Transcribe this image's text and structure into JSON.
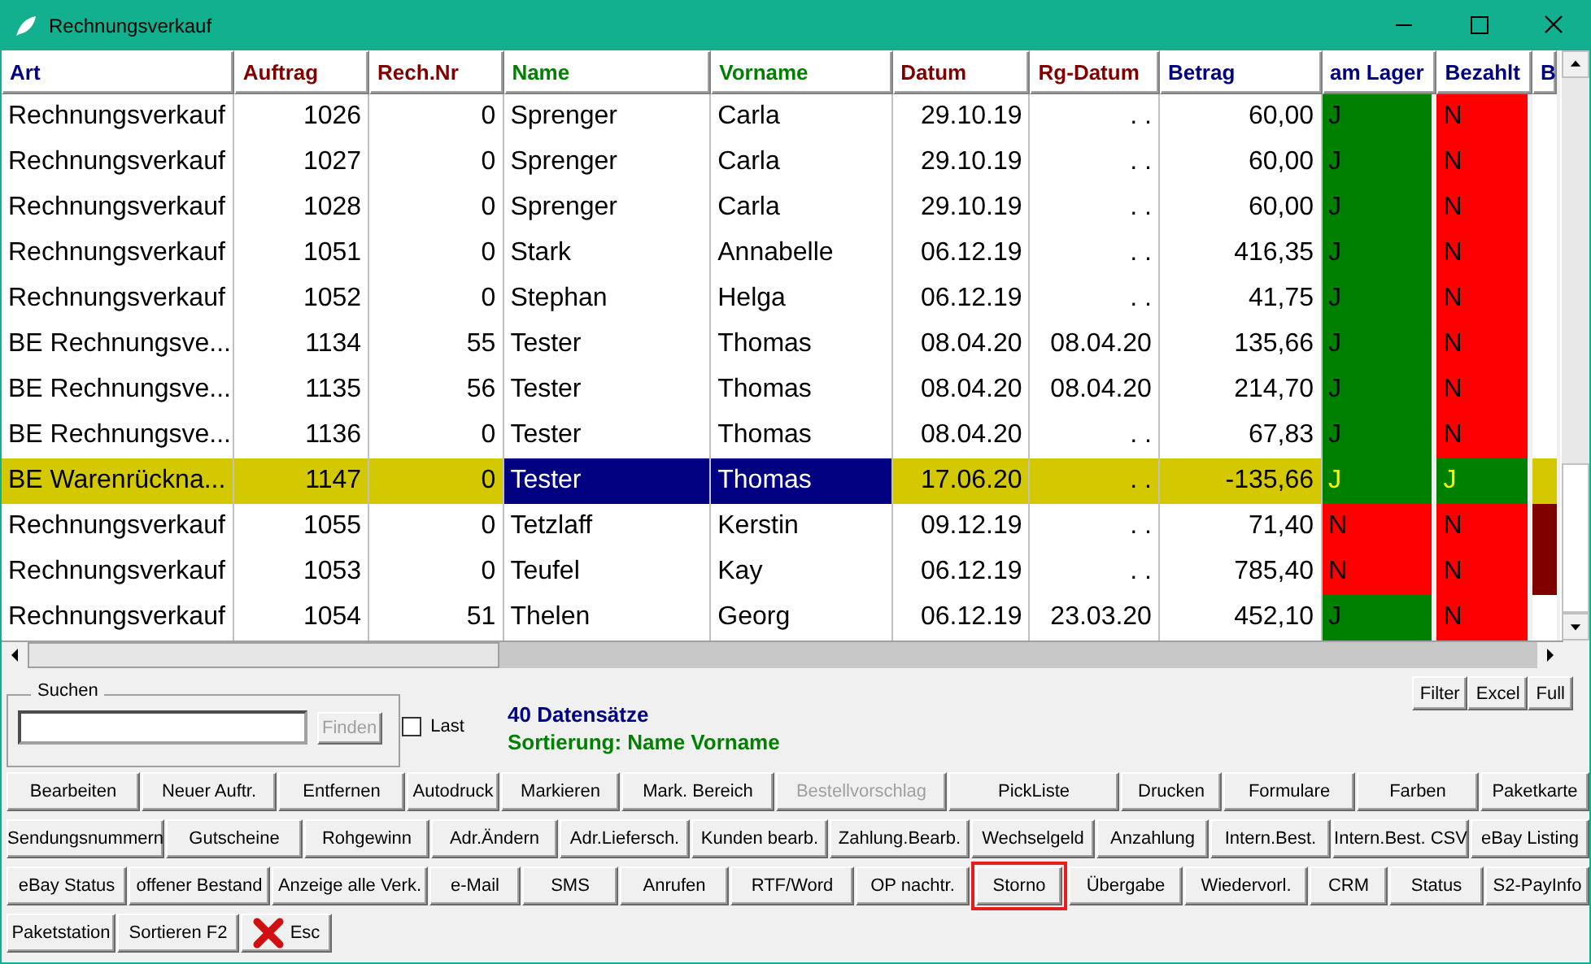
{
  "window": {
    "title": "Rechnungsverkauf"
  },
  "table": {
    "columns": [
      {
        "label": "Art",
        "color": "#000080"
      },
      {
        "label": "Auftrag",
        "color": "#800000"
      },
      {
        "label": "Rech.Nr",
        "color": "#800000"
      },
      {
        "label": "Name",
        "color": "#008000"
      },
      {
        "label": "Vorname",
        "color": "#008000"
      },
      {
        "label": "Datum",
        "color": "#800000"
      },
      {
        "label": "Rg-Datum",
        "color": "#800000"
      },
      {
        "label": "Betrag",
        "color": "#000080"
      },
      {
        "label": "am Lager",
        "color": "#000080"
      },
      {
        "label": "Bezahlt",
        "color": "#000080"
      },
      {
        "label": "B",
        "color": "#000080"
      }
    ],
    "rows": [
      {
        "cells": [
          "Rechnungsverkauf",
          "1026",
          "0",
          "Sprenger",
          "Carla",
          "29.10.19",
          ". .",
          "60,00"
        ],
        "am_lager": {
          "text": "J",
          "color": "#008000"
        },
        "bezahlt": {
          "text": "N",
          "color": "#ff0000"
        },
        "selected": false
      },
      {
        "cells": [
          "Rechnungsverkauf",
          "1027",
          "0",
          "Sprenger",
          "Carla",
          "29.10.19",
          ". .",
          "60,00"
        ],
        "am_lager": {
          "text": "J",
          "color": "#008000"
        },
        "bezahlt": {
          "text": "N",
          "color": "#ff0000"
        },
        "selected": false
      },
      {
        "cells": [
          "Rechnungsverkauf",
          "1028",
          "0",
          "Sprenger",
          "Carla",
          "29.10.19",
          ". .",
          "60,00"
        ],
        "am_lager": {
          "text": "J",
          "color": "#008000"
        },
        "bezahlt": {
          "text": "N",
          "color": "#ff0000"
        },
        "selected": false
      },
      {
        "cells": [
          "Rechnungsverkauf",
          "1051",
          "0",
          "Stark",
          "Annabelle",
          "06.12.19",
          ". .",
          "416,35"
        ],
        "am_lager": {
          "text": "J",
          "color": "#008000"
        },
        "bezahlt": {
          "text": "N",
          "color": "#ff0000"
        },
        "selected": false
      },
      {
        "cells": [
          "Rechnungsverkauf",
          "1052",
          "0",
          "Stephan",
          "Helga",
          "06.12.19",
          ". .",
          "41,75"
        ],
        "am_lager": {
          "text": "J",
          "color": "#008000"
        },
        "bezahlt": {
          "text": "N",
          "color": "#ff0000"
        },
        "selected": false
      },
      {
        "cells": [
          "BE Rechnungsve...",
          "1134",
          "55",
          "Tester",
          "Thomas",
          "08.04.20",
          "08.04.20",
          "135,66"
        ],
        "am_lager": {
          "text": "J",
          "color": "#008000"
        },
        "bezahlt": {
          "text": "N",
          "color": "#ff0000"
        },
        "selected": false
      },
      {
        "cells": [
          "BE Rechnungsve...",
          "1135",
          "56",
          "Tester",
          "Thomas",
          "08.04.20",
          "08.04.20",
          "214,70"
        ],
        "am_lager": {
          "text": "J",
          "color": "#008000"
        },
        "bezahlt": {
          "text": "N",
          "color": "#ff0000"
        },
        "selected": false
      },
      {
        "cells": [
          "BE Rechnungsve...",
          "1136",
          "0",
          "Tester",
          "Thomas",
          "08.04.20",
          ". .",
          "67,83"
        ],
        "am_lager": {
          "text": "J",
          "color": "#008000"
        },
        "bezahlt": {
          "text": "N",
          "color": "#ff0000"
        },
        "selected": false
      },
      {
        "cells": [
          "BE Warenrückna...",
          "1147",
          "0",
          "Tester",
          "Thomas",
          "17.06.20",
          ". .",
          "-135,66"
        ],
        "am_lager": {
          "text": "J",
          "color": "#008000"
        },
        "bezahlt": {
          "text": "J",
          "color": "#008000"
        },
        "selected": true
      },
      {
        "cells": [
          "Rechnungsverkauf",
          "1055",
          "0",
          "Tetzlaff",
          "Kerstin",
          "09.12.19",
          ". .",
          "71,40"
        ],
        "am_lager": {
          "text": "N",
          "color": "#ff0000"
        },
        "bezahlt": {
          "text": "N",
          "color": "#ff0000"
        },
        "flag": {
          "color": "#800000"
        },
        "selected": false
      },
      {
        "cells": [
          "Rechnungsverkauf",
          "1053",
          "0",
          "Teufel",
          "Kay",
          "06.12.19",
          ". .",
          "785,40"
        ],
        "am_lager": {
          "text": "N",
          "color": "#ff0000"
        },
        "bezahlt": {
          "text": "N",
          "color": "#ff0000"
        },
        "flag": {
          "color": "#800000"
        },
        "selected": false
      },
      {
        "cells": [
          "Rechnungsverkauf",
          "1054",
          "51",
          "Thelen",
          "Georg",
          "06.12.19",
          "23.03.20",
          "452,10"
        ],
        "am_lager": {
          "text": "J",
          "color": "#008000"
        },
        "bezahlt": {
          "text": "N",
          "color": "#ff0000"
        },
        "selected": false
      }
    ]
  },
  "search": {
    "legend": "Suchen",
    "find_button": {
      "label": "Finden",
      "disabled": true
    },
    "last": {
      "label": "Last",
      "checked": false
    }
  },
  "status": {
    "record_count": "40 Datensätze",
    "sorting": "Sortierung: Name Vorname"
  },
  "tools": [
    "Filter",
    "Excel",
    "Full"
  ],
  "button_rows": [
    [
      {
        "label": "Bearbeiten",
        "kind": "text",
        "disabled": false,
        "highlighted": false
      },
      {
        "label": "Neuer Auftr.",
        "kind": "text",
        "disabled": false,
        "highlighted": false
      },
      {
        "label": "Entfernen",
        "kind": "text",
        "disabled": false,
        "highlighted": false
      },
      {
        "label": "Autodruck",
        "kind": "text",
        "disabled": false,
        "highlighted": false
      },
      {
        "label": "Markieren",
        "kind": "text",
        "disabled": false,
        "highlighted": false
      },
      {
        "label": "Mark. Bereich",
        "kind": "text",
        "disabled": false,
        "highlighted": false
      },
      {
        "label": "Bestellvorschlag",
        "kind": "text",
        "disabled": true,
        "highlighted": false
      },
      {
        "label": "PickListe",
        "kind": "text",
        "disabled": false,
        "highlighted": false
      },
      {
        "label": "Drucken",
        "kind": "text",
        "disabled": false,
        "highlighted": false
      },
      {
        "label": "Formulare",
        "kind": "text",
        "disabled": false,
        "highlighted": false
      },
      {
        "label": "Farben",
        "kind": "text",
        "disabled": false,
        "highlighted": false
      },
      {
        "label": "Paketkarte",
        "kind": "text",
        "disabled": false,
        "highlighted": false
      }
    ],
    [
      {
        "label": "Sendungsnummern",
        "kind": "text",
        "disabled": false,
        "highlighted": false
      },
      {
        "label": "Gutscheine",
        "kind": "text",
        "disabled": false,
        "highlighted": false
      },
      {
        "label": "Rohgewinn",
        "kind": "text",
        "disabled": false,
        "highlighted": false
      },
      {
        "label": "Adr.Ändern",
        "kind": "text",
        "disabled": false,
        "highlighted": false
      },
      {
        "label": "Adr.Liefersch.",
        "kind": "text",
        "disabled": false,
        "highlighted": false
      },
      {
        "label": "Kunden bearb.",
        "kind": "text",
        "disabled": false,
        "highlighted": false
      },
      {
        "label": "Zahlung.Bearb.",
        "kind": "text",
        "disabled": false,
        "highlighted": false
      },
      {
        "label": "Wechselgeld",
        "kind": "text",
        "disabled": false,
        "highlighted": false
      },
      {
        "label": "Anzahlung",
        "kind": "text",
        "disabled": false,
        "highlighted": false
      },
      {
        "label": "Intern.Best.",
        "kind": "text",
        "disabled": false,
        "highlighted": false
      },
      {
        "label": "Intern.Best. CSV",
        "kind": "text",
        "disabled": false,
        "highlighted": false
      },
      {
        "label": "eBay Listing",
        "kind": "text",
        "disabled": false,
        "highlighted": false
      }
    ],
    [
      {
        "label": "eBay Status",
        "kind": "text",
        "disabled": false,
        "highlighted": false
      },
      {
        "label": "offener Bestand",
        "kind": "text",
        "disabled": false,
        "highlighted": false
      },
      {
        "label": "Anzeige alle Verk.",
        "kind": "text",
        "disabled": false,
        "highlighted": false
      },
      {
        "label": "e-Mail",
        "kind": "text",
        "disabled": false,
        "highlighted": false
      },
      {
        "label": "SMS",
        "kind": "text",
        "disabled": false,
        "highlighted": false
      },
      {
        "label": "Anrufen",
        "kind": "text",
        "disabled": false,
        "highlighted": false
      },
      {
        "label": "RTF/Word",
        "kind": "text",
        "disabled": false,
        "highlighted": false
      },
      {
        "label": "OP nachtr.",
        "kind": "text",
        "disabled": false,
        "highlighted": false
      },
      {
        "label": "Storno",
        "kind": "text",
        "disabled": false,
        "highlighted": true
      },
      {
        "label": "Übergabe",
        "kind": "text",
        "disabled": false,
        "highlighted": false
      },
      {
        "label": "Wiedervorl.",
        "kind": "text",
        "disabled": false,
        "highlighted": false
      },
      {
        "label": "CRM",
        "kind": "text",
        "disabled": false,
        "highlighted": false
      },
      {
        "label": "Status",
        "kind": "text",
        "disabled": false,
        "highlighted": false
      },
      {
        "label": "S2-PayInfo",
        "kind": "text",
        "disabled": false,
        "highlighted": false
      }
    ],
    [
      {
        "label": "Paketstation",
        "kind": "text",
        "disabled": false,
        "highlighted": false
      },
      {
        "label": "Sortieren F2",
        "kind": "text",
        "disabled": false,
        "highlighted": false
      },
      {
        "label": "Esc",
        "kind": "cancel",
        "disabled": false,
        "highlighted": false
      }
    ]
  ]
}
